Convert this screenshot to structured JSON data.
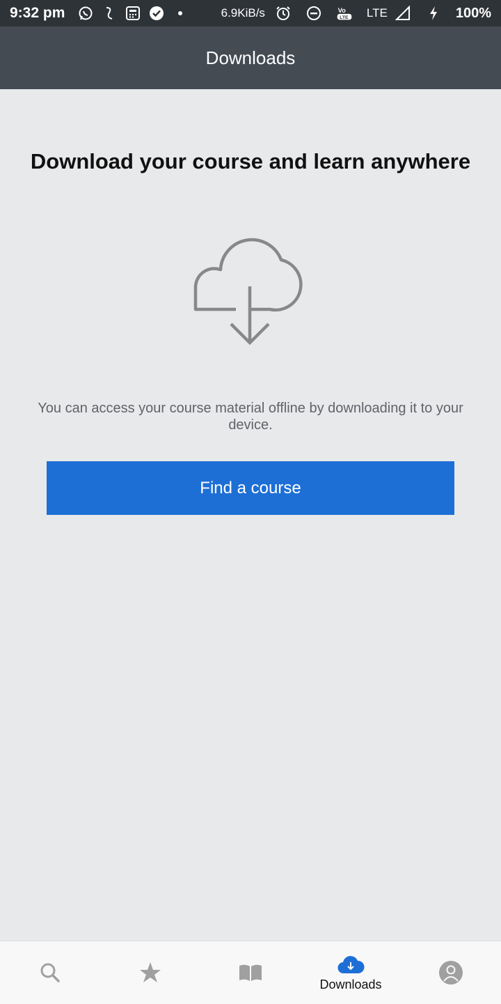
{
  "status_bar": {
    "time": "9:32 pm",
    "speed": "6.9KiB/s",
    "volte": "VoLTE",
    "network": "LTE",
    "battery": "100%"
  },
  "app_bar": {
    "title": "Downloads"
  },
  "main": {
    "headline": "Download your course and learn anywhere",
    "description": "You can access your course material offline by downloading it to your device.",
    "find_button_label": "Find a course",
    "illustration_icon": "cloud-download-icon"
  },
  "bottom_nav": {
    "items": [
      {
        "icon": "search-icon",
        "label": ""
      },
      {
        "icon": "star-icon",
        "label": ""
      },
      {
        "icon": "book-icon",
        "label": ""
      },
      {
        "icon": "cloud-download-icon",
        "label": "Downloads",
        "active": true
      },
      {
        "icon": "profile-icon",
        "label": ""
      }
    ]
  },
  "colors": {
    "accent": "#1d6fd6",
    "app_bar": "#444b53",
    "status_bar": "#2e3338",
    "background": "#e8e9eb"
  }
}
